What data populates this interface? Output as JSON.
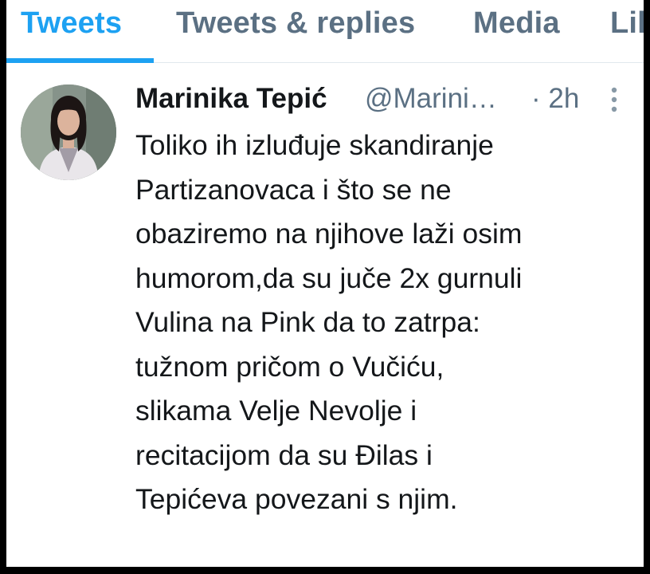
{
  "tabs": [
    {
      "label": "Tweets",
      "active": true
    },
    {
      "label": "Tweets & replies",
      "active": false
    },
    {
      "label": "Media",
      "active": false
    },
    {
      "label": "Lil",
      "active": false
    }
  ],
  "tweet": {
    "author_name": "Marinika Tepić",
    "author_handle": "@Marini…",
    "time": "· 2h",
    "text_lines": [
      "Toliko ih izluđuje skandiranje",
      "Partizanovaca i što se ne",
      "obaziremo na njihove laži osim",
      "humorom,da su juče 2x gurnuli",
      "Vulina na Pink da to zatrpa:",
      "tužnom pričom o Vučiću,",
      "slikama Velje Nevolje i",
      "recitacijom da su Đilas i",
      "Tepićeva povezani s njim."
    ],
    "more_icon": "vertical-ellipsis-icon"
  },
  "colors": {
    "accent": "#1da1f2",
    "secondary_text": "#5b7083",
    "primary_text": "#14171a",
    "outer_border": "#000000"
  }
}
